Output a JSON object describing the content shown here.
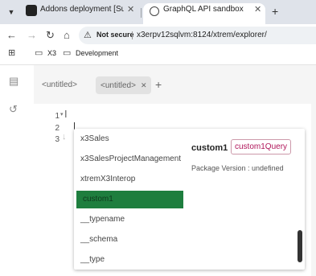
{
  "browser": {
    "tabs": [
      {
        "title": "Addons deployment [Super adm"
      },
      {
        "title": "GraphQL API sandbox"
      }
    ],
    "not_secure": "Not secure",
    "url": "x3erpv12sqlvm:8124/xtrem/explorer/",
    "bookmarks": [
      {
        "label": "X3"
      },
      {
        "label": "Development"
      }
    ]
  },
  "app": {
    "doc_tabs": [
      {
        "label": "<untitled>"
      },
      {
        "label": "<untitled>"
      }
    ],
    "line_numbers": [
      "1",
      "2",
      "3"
    ],
    "autocomplete": {
      "items": [
        "x3Sales",
        "x3SalesProjectManagement",
        "xtremX3Interop",
        "custom1",
        "__typename",
        "__schema",
        "__type"
      ],
      "selected_index": 3,
      "detail_name": "custom1",
      "detail_type": "custom1Query",
      "detail_sub": "Package Version : undefined"
    }
  },
  "colors": {
    "selected": "#1e7e3e",
    "type_badge": "#b0165a"
  }
}
